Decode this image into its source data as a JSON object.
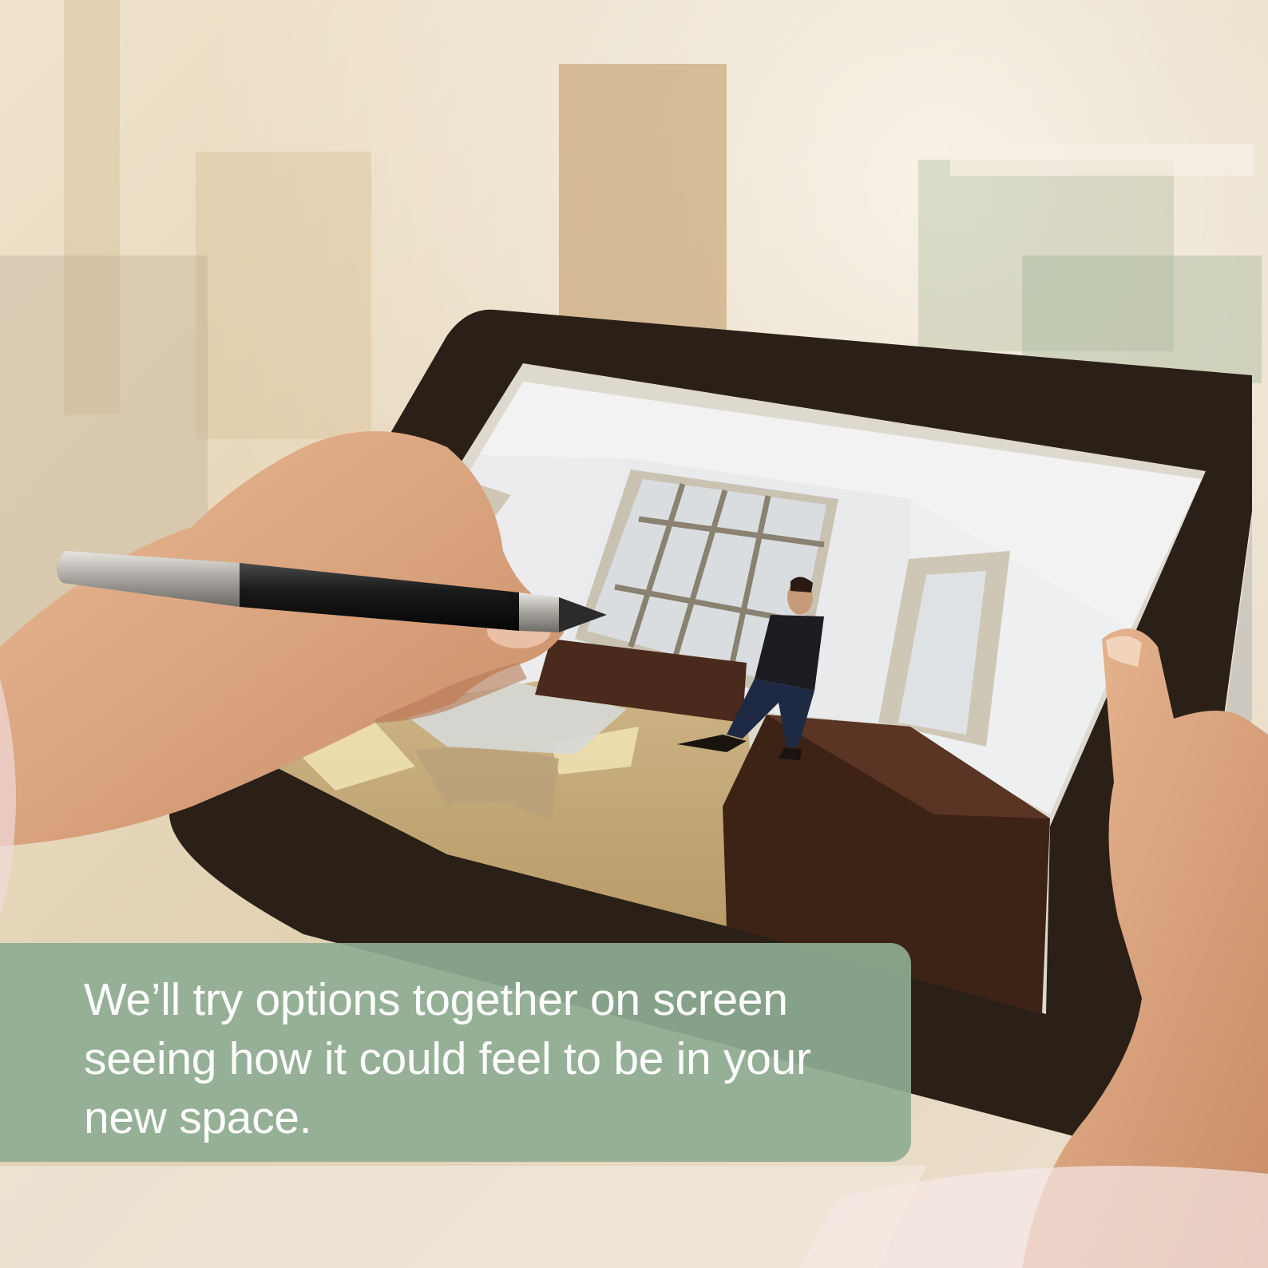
{
  "caption": {
    "text": "We’ll try options together on screen\nseeing how it could feel to be in your\nnew space."
  },
  "colors": {
    "caption_panel": "#8eac94",
    "caption_text": "#ffffff",
    "background_warm": "#e9dcc4",
    "tablet_bezel": "#2a2018",
    "screen_wall": "#e6e7e8",
    "screen_floor": "#d8c290",
    "furniture_dark": "#4a2a1c"
  },
  "icons": [
    "stylus-icon"
  ]
}
